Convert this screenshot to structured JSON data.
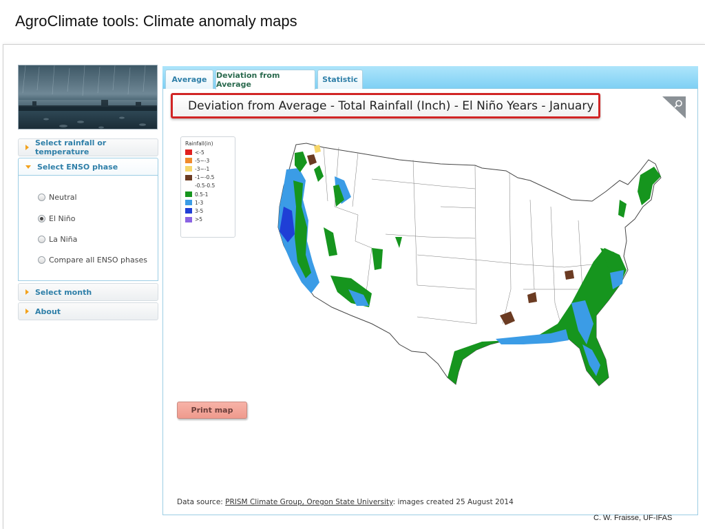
{
  "slide": {
    "title": "AgroClimate tools: Climate anomaly maps",
    "credit": "C. W. Fraisse, UF-IFAS"
  },
  "sidebar": {
    "hero_image": "rainy-landscape-photo",
    "sections": [
      {
        "label": "Select rainfall or temperature",
        "expanded": false
      },
      {
        "label": "Select ENSO phase",
        "expanded": true
      },
      {
        "label": "Select month",
        "expanded": false
      },
      {
        "label": "About",
        "expanded": false
      }
    ],
    "enso_options": [
      {
        "label": "Neutral",
        "selected": false
      },
      {
        "label": "El Niño",
        "selected": true
      },
      {
        "label": "La Niña",
        "selected": false
      },
      {
        "label": "Compare all ENSO phases",
        "selected": false
      }
    ]
  },
  "tabs": [
    {
      "label": "Average",
      "active": false
    },
    {
      "label": "Deviation from Average",
      "active": true
    },
    {
      "label": "Statistic",
      "active": false
    }
  ],
  "map": {
    "title": "Deviation from Average - Total Rainfall (Inch) - El Niño Years - January",
    "zoom_icon": "magnifier-icon",
    "legend": {
      "title": "Rainfall(in)",
      "items": [
        {
          "label": "<-5",
          "color": "#e02020"
        },
        {
          "label": "-5~-3",
          "color": "#f08a2c"
        },
        {
          "label": "-3~-1",
          "color": "#f6d66a"
        },
        {
          "label": "-1~-0.5",
          "color": "#6b3b22"
        },
        {
          "label": "-0.5-0.5",
          "color": "#ffffff"
        },
        {
          "label": "0.5-1",
          "color": "#16951e"
        },
        {
          "label": "1-3",
          "color": "#3b9ce6"
        },
        {
          "label": "3-5",
          "color": "#1f3fd6"
        },
        {
          "label": ">5",
          "color": "#8a63e3"
        }
      ]
    },
    "print_label": "Print map"
  },
  "footer": {
    "prefix": "Data source: ",
    "link": "PRISM Climate Group, Oregon State University",
    "suffix": ": images created 25 August 2014"
  },
  "colors": {
    "accent_blue": "#2f7fa8",
    "tab_bar": "#8fd6f6",
    "title_border": "#d12424",
    "print_button": "#f2a397"
  }
}
